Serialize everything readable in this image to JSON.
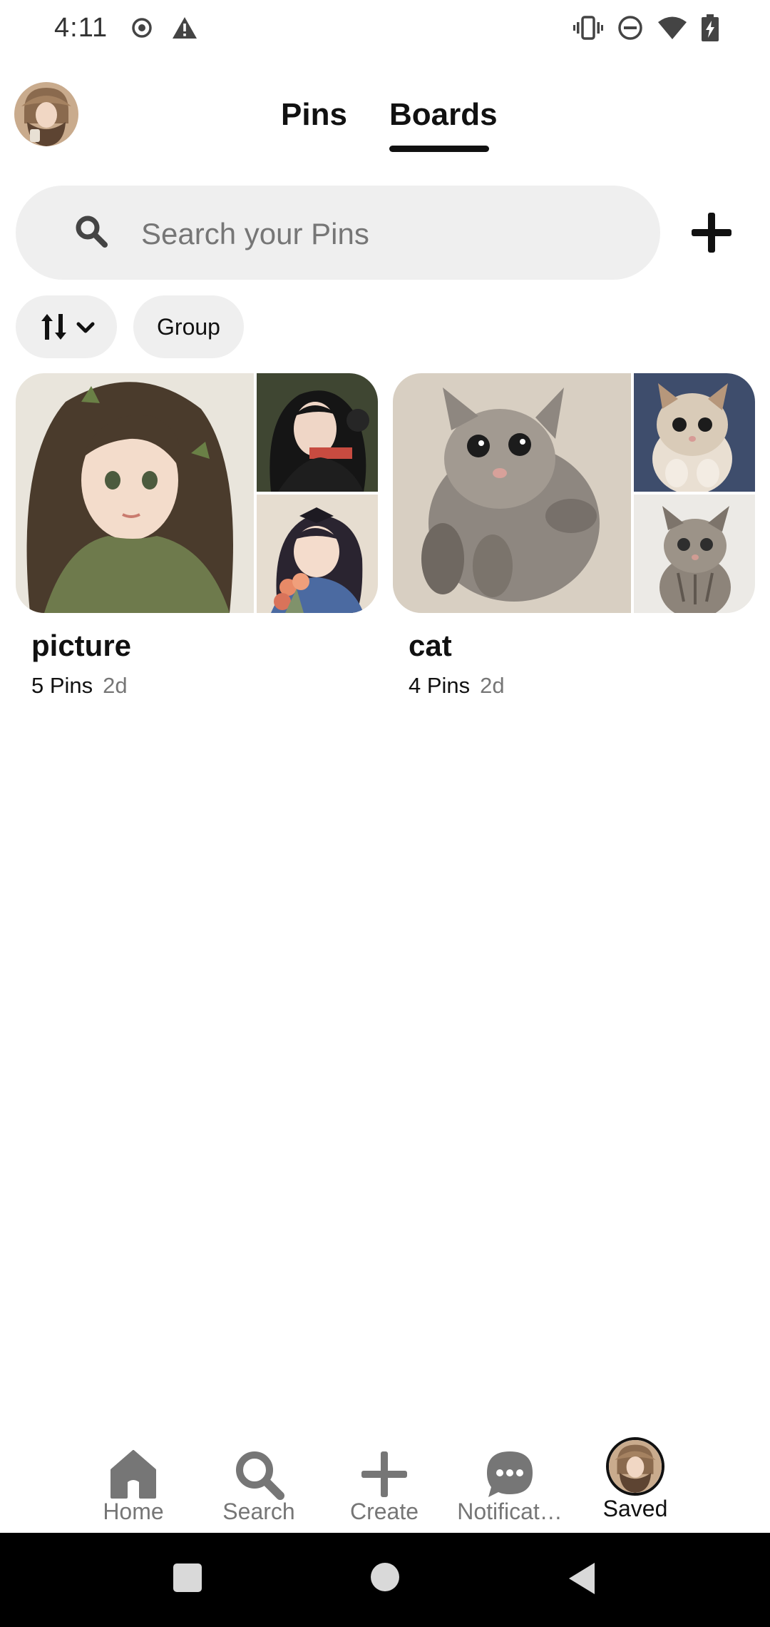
{
  "status_bar": {
    "time": "4:11",
    "left_icons": [
      "record-icon",
      "warning-icon"
    ],
    "right_icons": [
      "vibrate-icon",
      "do-not-disturb-icon",
      "wifi-icon",
      "battery-charging-icon"
    ]
  },
  "header": {
    "tabs": [
      {
        "label": "Pins",
        "active": false
      },
      {
        "label": "Boards",
        "active": true
      }
    ]
  },
  "search": {
    "placeholder": "Search your Pins"
  },
  "filters": {
    "group_label": "Group"
  },
  "boards": [
    {
      "title": "picture",
      "pins": "5 Pins",
      "age": "2d"
    },
    {
      "title": "cat",
      "pins": "4 Pins",
      "age": "2d"
    }
  ],
  "bottom_nav": {
    "items": [
      {
        "label": "Home",
        "icon": "home-icon"
      },
      {
        "label": "Search",
        "icon": "search-icon"
      },
      {
        "label": "Create",
        "icon": "plus-icon"
      },
      {
        "label": "Notificat…",
        "icon": "chat-bubble-icon"
      },
      {
        "label": "Saved",
        "icon": "profile-avatar",
        "active": true
      }
    ]
  },
  "colors": {
    "text_primary": "#111111",
    "text_secondary": "#767676",
    "chip_background": "#efefef",
    "system_nav_background": "#000000"
  }
}
